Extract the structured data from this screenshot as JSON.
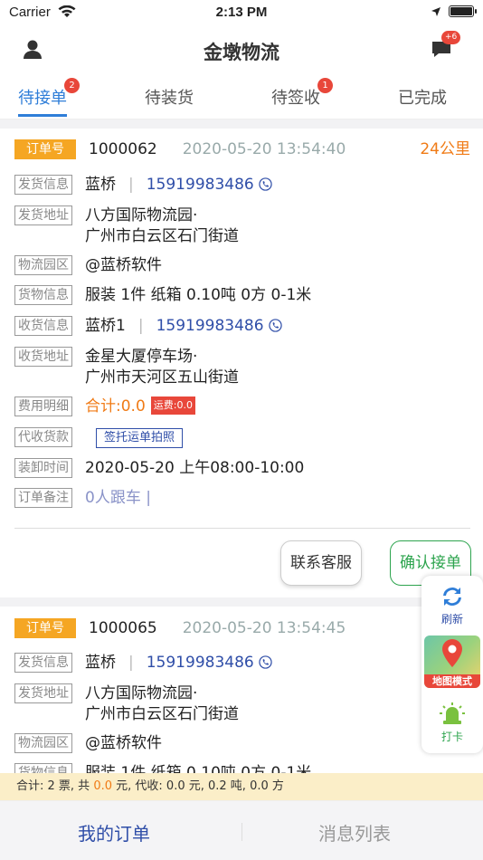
{
  "status_bar": {
    "carrier": "Carrier",
    "time": "2:13 PM"
  },
  "nav": {
    "title": "金墩物流",
    "msg_badge": "+6"
  },
  "tabs": [
    {
      "label": "待接单",
      "badge": "2",
      "active": true
    },
    {
      "label": "待装货"
    },
    {
      "label": "待签收",
      "badge": "1"
    },
    {
      "label": "已完成"
    }
  ],
  "orders": [
    {
      "order_label": "订单号",
      "order_no": "1000062",
      "datetime": "2020-05-20 13:54:40",
      "distance": "24公里",
      "sender_label": "发货信息",
      "sender_name": "蓝桥",
      "sender_phone": "15919983486",
      "sender_addr_label": "发货地址",
      "sender_addr_1": "八方国际物流园·",
      "sender_addr_2": "广州市白云区石门街道",
      "park_label": "物流园区",
      "park": "@蓝桥软件",
      "goods_label": "货物信息",
      "goods": "服装 1件 纸箱 0.10吨 0方 0-1米",
      "receiver_label": "收货信息",
      "receiver_name": "蓝桥1",
      "receiver_phone": "15919983486",
      "receiver_addr_label": "收货地址",
      "receiver_addr_1": "金星大厦停车场·",
      "receiver_addr_2": "广州市天河区五山街道",
      "fee_label": "费用明细",
      "fee_total": "合计:0.0",
      "fee_tag": "运费:0.0",
      "cod_label": "代收货款",
      "cod_btn": "签托运单拍照",
      "load_label": "装卸时间",
      "load_time": "2020-05-20 上午08:00-10:00",
      "remark_label": "订单备注",
      "remark": "0人跟车 |",
      "service_btn": "联系客服",
      "accept_btn": "确认接单"
    },
    {
      "order_label": "订单号",
      "order_no": "1000065",
      "datetime": "2020-05-20 13:54:45",
      "sender_label": "发货信息",
      "sender_name": "蓝桥",
      "sender_phone": "15919983486",
      "sender_addr_label": "发货地址",
      "sender_addr_1": "八方国际物流园·",
      "sender_addr_2": "广州市白云区石门街道",
      "park_label": "物流园区",
      "park": "@蓝桥软件",
      "goods_label": "货物信息",
      "goods": "服装 1件 纸箱 0.10吨 0方 0-1米"
    }
  ],
  "float_menu": {
    "refresh": "刷新",
    "map": "地图模式",
    "checkin": "打卡"
  },
  "summary": {
    "prefix": "合计: 2 票, 共 ",
    "amount": "0.0",
    "suffix": " 元, 代收: 0.0 元, 0.2 吨, 0.0 方"
  },
  "bottom_tabs": {
    "orders": "我的订单",
    "messages": "消息列表"
  },
  "colors": {
    "accent": "#2f7ed8",
    "order_tag": "#f5a623",
    "badge": "#e8473a",
    "accept": "#2da44e",
    "phone": "#2f4ea8"
  }
}
